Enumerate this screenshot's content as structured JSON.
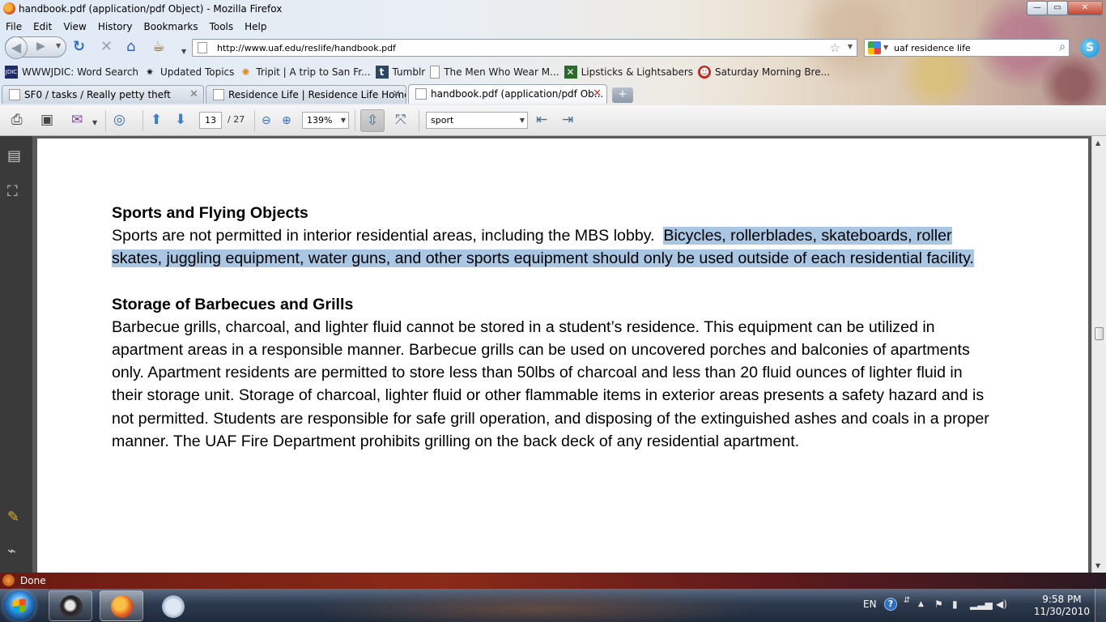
{
  "window": {
    "title": "handbook.pdf (application/pdf Object) - Mozilla Firefox",
    "buttons": {
      "minimize": "—",
      "maximize": "▭",
      "close": "✕"
    }
  },
  "menu": [
    "File",
    "Edit",
    "View",
    "History",
    "Bookmarks",
    "Tools",
    "Help"
  ],
  "navigation": {
    "url": "http://www.uaf.edu/reslife/handbook.pdf",
    "search_value": "uaf residence life"
  },
  "bookmarks": [
    {
      "label": "WWWJDIC: Word Search",
      "icon": "wwwjdic-icon"
    },
    {
      "label": "Updated Topics",
      "icon": "splat-icon"
    },
    {
      "label": "Tripit | A trip to San Fr...",
      "icon": "tripit-icon"
    },
    {
      "label": "Tumblr",
      "icon": "tumblr-icon"
    },
    {
      "label": "The Men Who Wear M...",
      "icon": "page-icon"
    },
    {
      "label": "Lipsticks & Lightsabers",
      "icon": "lipstick-icon"
    },
    {
      "label": "Saturday Morning Bre...",
      "icon": "smbc-icon"
    }
  ],
  "tabs": [
    {
      "label": "SF0 / tasks / Really petty theft",
      "active": false
    },
    {
      "label": "Residence Life | Residence Life Home",
      "active": false
    },
    {
      "label": "handbook.pdf (application/pdf Ob...",
      "active": true
    }
  ],
  "pdf_toolbar": {
    "page_current": "13",
    "page_total": "/ 27",
    "zoom": "139%",
    "find": "sport"
  },
  "pdf": {
    "section1_heading": "Sports and Flying Objects",
    "section1_plain": "Sports are not permitted in interior residential areas, including the MBS lobby.  ",
    "section1_highlighted": "Bicycles, rollerblades, skateboards, roller skates, juggling equipment, water guns, and other sports equipment should only be used outside of each residential facility.",
    "section2_heading": "Storage of Barbecues and Grills",
    "section2_body": "Barbecue grills, charcoal, and lighter fluid cannot be stored in a student’s residence. This equipment can be utilized in apartment areas in a responsible manner. Barbecue grills can be used on uncovered porches and balconies of apartments only. Apartment residents are permitted to store less than 50lbs of charcoal and less than 20 fluid ounces of lighter fluid in their storage unit. Storage of charcoal, lighter fluid or other flammable items in exterior areas presents a safety hazard and is not permitted. Students are responsible for safe grill operation, and disposing of the extinguished ashes and coals in a proper manner. The UAF Fire Department prohibits grilling on the back deck of any residential apartment."
  },
  "status": {
    "text": "Done"
  },
  "taskbar": {
    "language": "EN",
    "help": "?",
    "time": "9:58 PM",
    "date": "11/30/2010"
  },
  "colors": {
    "selection_highlight": "#a9c6e2",
    "status_bar": "#8a2a18",
    "taskbar": "#2d3a4e"
  }
}
